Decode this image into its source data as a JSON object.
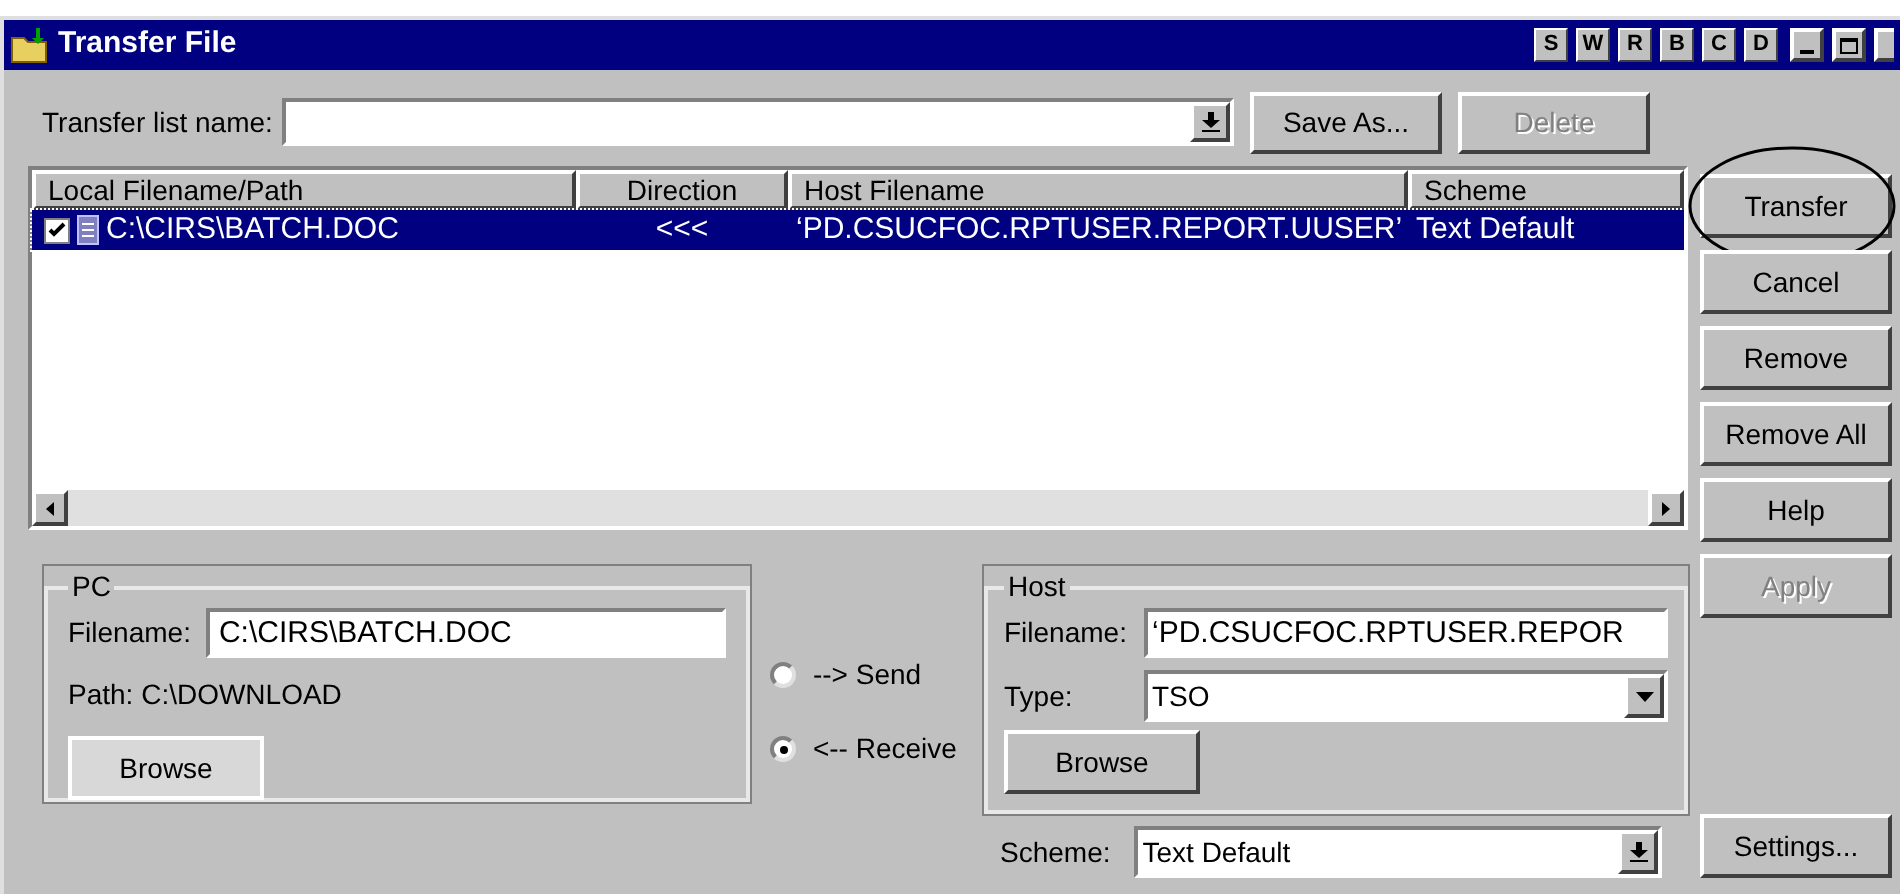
{
  "window": {
    "title": "Transfer File",
    "title_buttons": [
      "S",
      "W",
      "R",
      "B",
      "C",
      "D"
    ]
  },
  "transfer_list": {
    "label": "Transfer list name:",
    "buttons": [
      {
        "label": "Save As...",
        "disabled": false
      },
      {
        "label": "Delete",
        "disabled": true
      }
    ]
  },
  "table": {
    "columns": [
      "Local Filename/Path",
      "Direction",
      "Host Filename",
      "Scheme"
    ],
    "rows": [
      {
        "checked": true,
        "selected": true,
        "cells": [
          "C:\\CIRS\\BATCH.DOC",
          "<<<",
          "‘PD.CSUCFOC.RPTUSER.REPORT.UUSER’",
          "Text Default"
        ]
      }
    ]
  },
  "pc": {
    "title": "PC",
    "filename_label": "Filename:",
    "filename": "C:\\CIRS\\BATCH.DOC",
    "path": "Path: C:\\DOWNLOAD",
    "browse": "Browse"
  },
  "direction": [
    {
      "label": "--> Send",
      "selected": false
    },
    {
      "label": "<-- Receive",
      "selected": true
    }
  ],
  "host": {
    "title": "Host",
    "filename_label": "Filename:",
    "filename": "‘PD.CSUCFOC.RPTUSER.REPOR",
    "type_label": "Type:",
    "type": "TSO",
    "browse": "Browse"
  },
  "scheme": {
    "label": "Scheme:",
    "value": "Text Default"
  },
  "side_buttons": [
    {
      "label": "Transfer",
      "disabled": false,
      "circled": true
    },
    {
      "label": "Cancel",
      "disabled": false,
      "circled": false
    },
    {
      "label": "Remove",
      "disabled": false,
      "circled": false
    },
    {
      "label": "Remove All",
      "disabled": false,
      "circled": false
    },
    {
      "label": "Help",
      "disabled": false,
      "circled": false
    },
    {
      "label": "Apply",
      "disabled": true,
      "circled": false
    }
  ],
  "settings_button": {
    "label": "Settings...",
    "disabled": false
  }
}
